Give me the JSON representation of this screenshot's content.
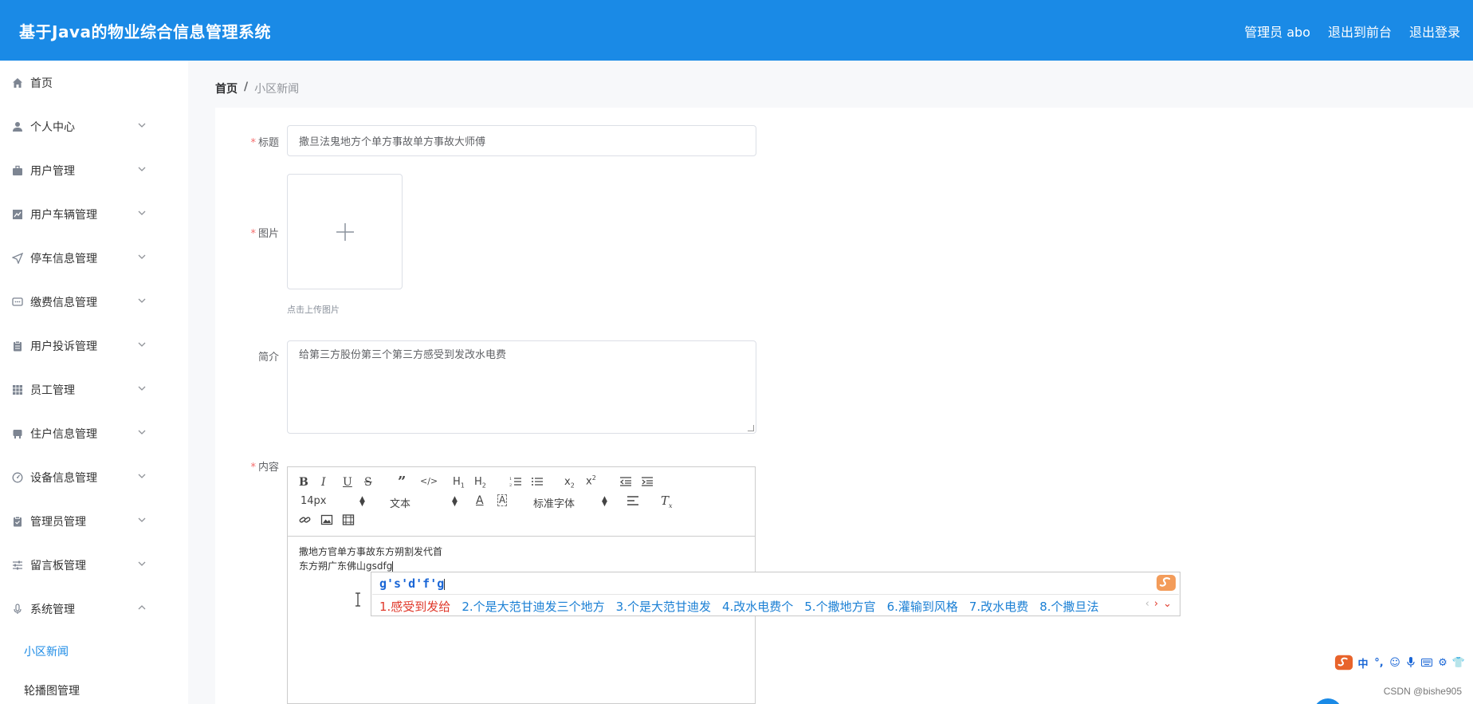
{
  "header": {
    "title": "基于Java的物业综合信息管理系统",
    "admin_label": "管理员 abo",
    "exit_front": "退出到前台",
    "logout": "退出登录"
  },
  "sidebar": {
    "items": [
      {
        "label": "首页",
        "icon": "home-icon"
      },
      {
        "label": "个人中心",
        "icon": "user-icon"
      },
      {
        "label": "用户管理",
        "icon": "briefcase-icon"
      },
      {
        "label": "用户车辆管理",
        "icon": "chart-icon"
      },
      {
        "label": "停车信息管理",
        "icon": "location-arrow-icon"
      },
      {
        "label": "缴费信息管理",
        "icon": "chat-icon"
      },
      {
        "label": "用户投诉管理",
        "icon": "clipboard-icon"
      },
      {
        "label": "员工管理",
        "icon": "grid-icon"
      },
      {
        "label": "住户信息管理",
        "icon": "house-icon"
      },
      {
        "label": "设备信息管理",
        "icon": "gauge-icon"
      },
      {
        "label": "管理员管理",
        "icon": "clipboard-check-icon"
      },
      {
        "label": "留言板管理",
        "icon": "sliders-icon"
      },
      {
        "label": "系统管理",
        "icon": "microphone-icon"
      }
    ],
    "sub_items": [
      {
        "label": "小区新闻",
        "active": true
      },
      {
        "label": "轮播图管理",
        "active": false
      }
    ]
  },
  "breadcrumb": {
    "home": "首页",
    "separator": "/",
    "current": "小区新闻"
  },
  "form": {
    "title_label": "标题",
    "title_value": "撒旦法鬼地方个单方事故单方事故大师傅",
    "image_label": "图片",
    "upload_tip": "点击上传图片",
    "intro_label": "简介",
    "intro_value": "给第三方股份第三个第三方感受到发改水电费",
    "content_label": "内容",
    "required_mark": "*"
  },
  "editor": {
    "font_size": "14px",
    "text_type": "文本",
    "font_family": "标准字体",
    "line1": "撒地方官单方事故东方朔割发代首",
    "line2": "东方朔广东佛山gsdfg"
  },
  "ime": {
    "pinyin": "g's'd'f'g",
    "candidates": [
      "1.感受到发给",
      "2.个是大范甘迪发三个地方",
      "3.个是大范甘迪发",
      "4.改水电费个",
      "5.个撒地方官",
      "6.灌输到风格",
      "7.改水电费",
      "8.个撒旦法"
    ]
  },
  "ime_bar": {
    "lang": "中"
  },
  "watermark": "CSDN @bishe905",
  "colors": {
    "primary": "#1a8ae6",
    "required": "#f56c6c",
    "ime_highlight": "#e0392b"
  }
}
